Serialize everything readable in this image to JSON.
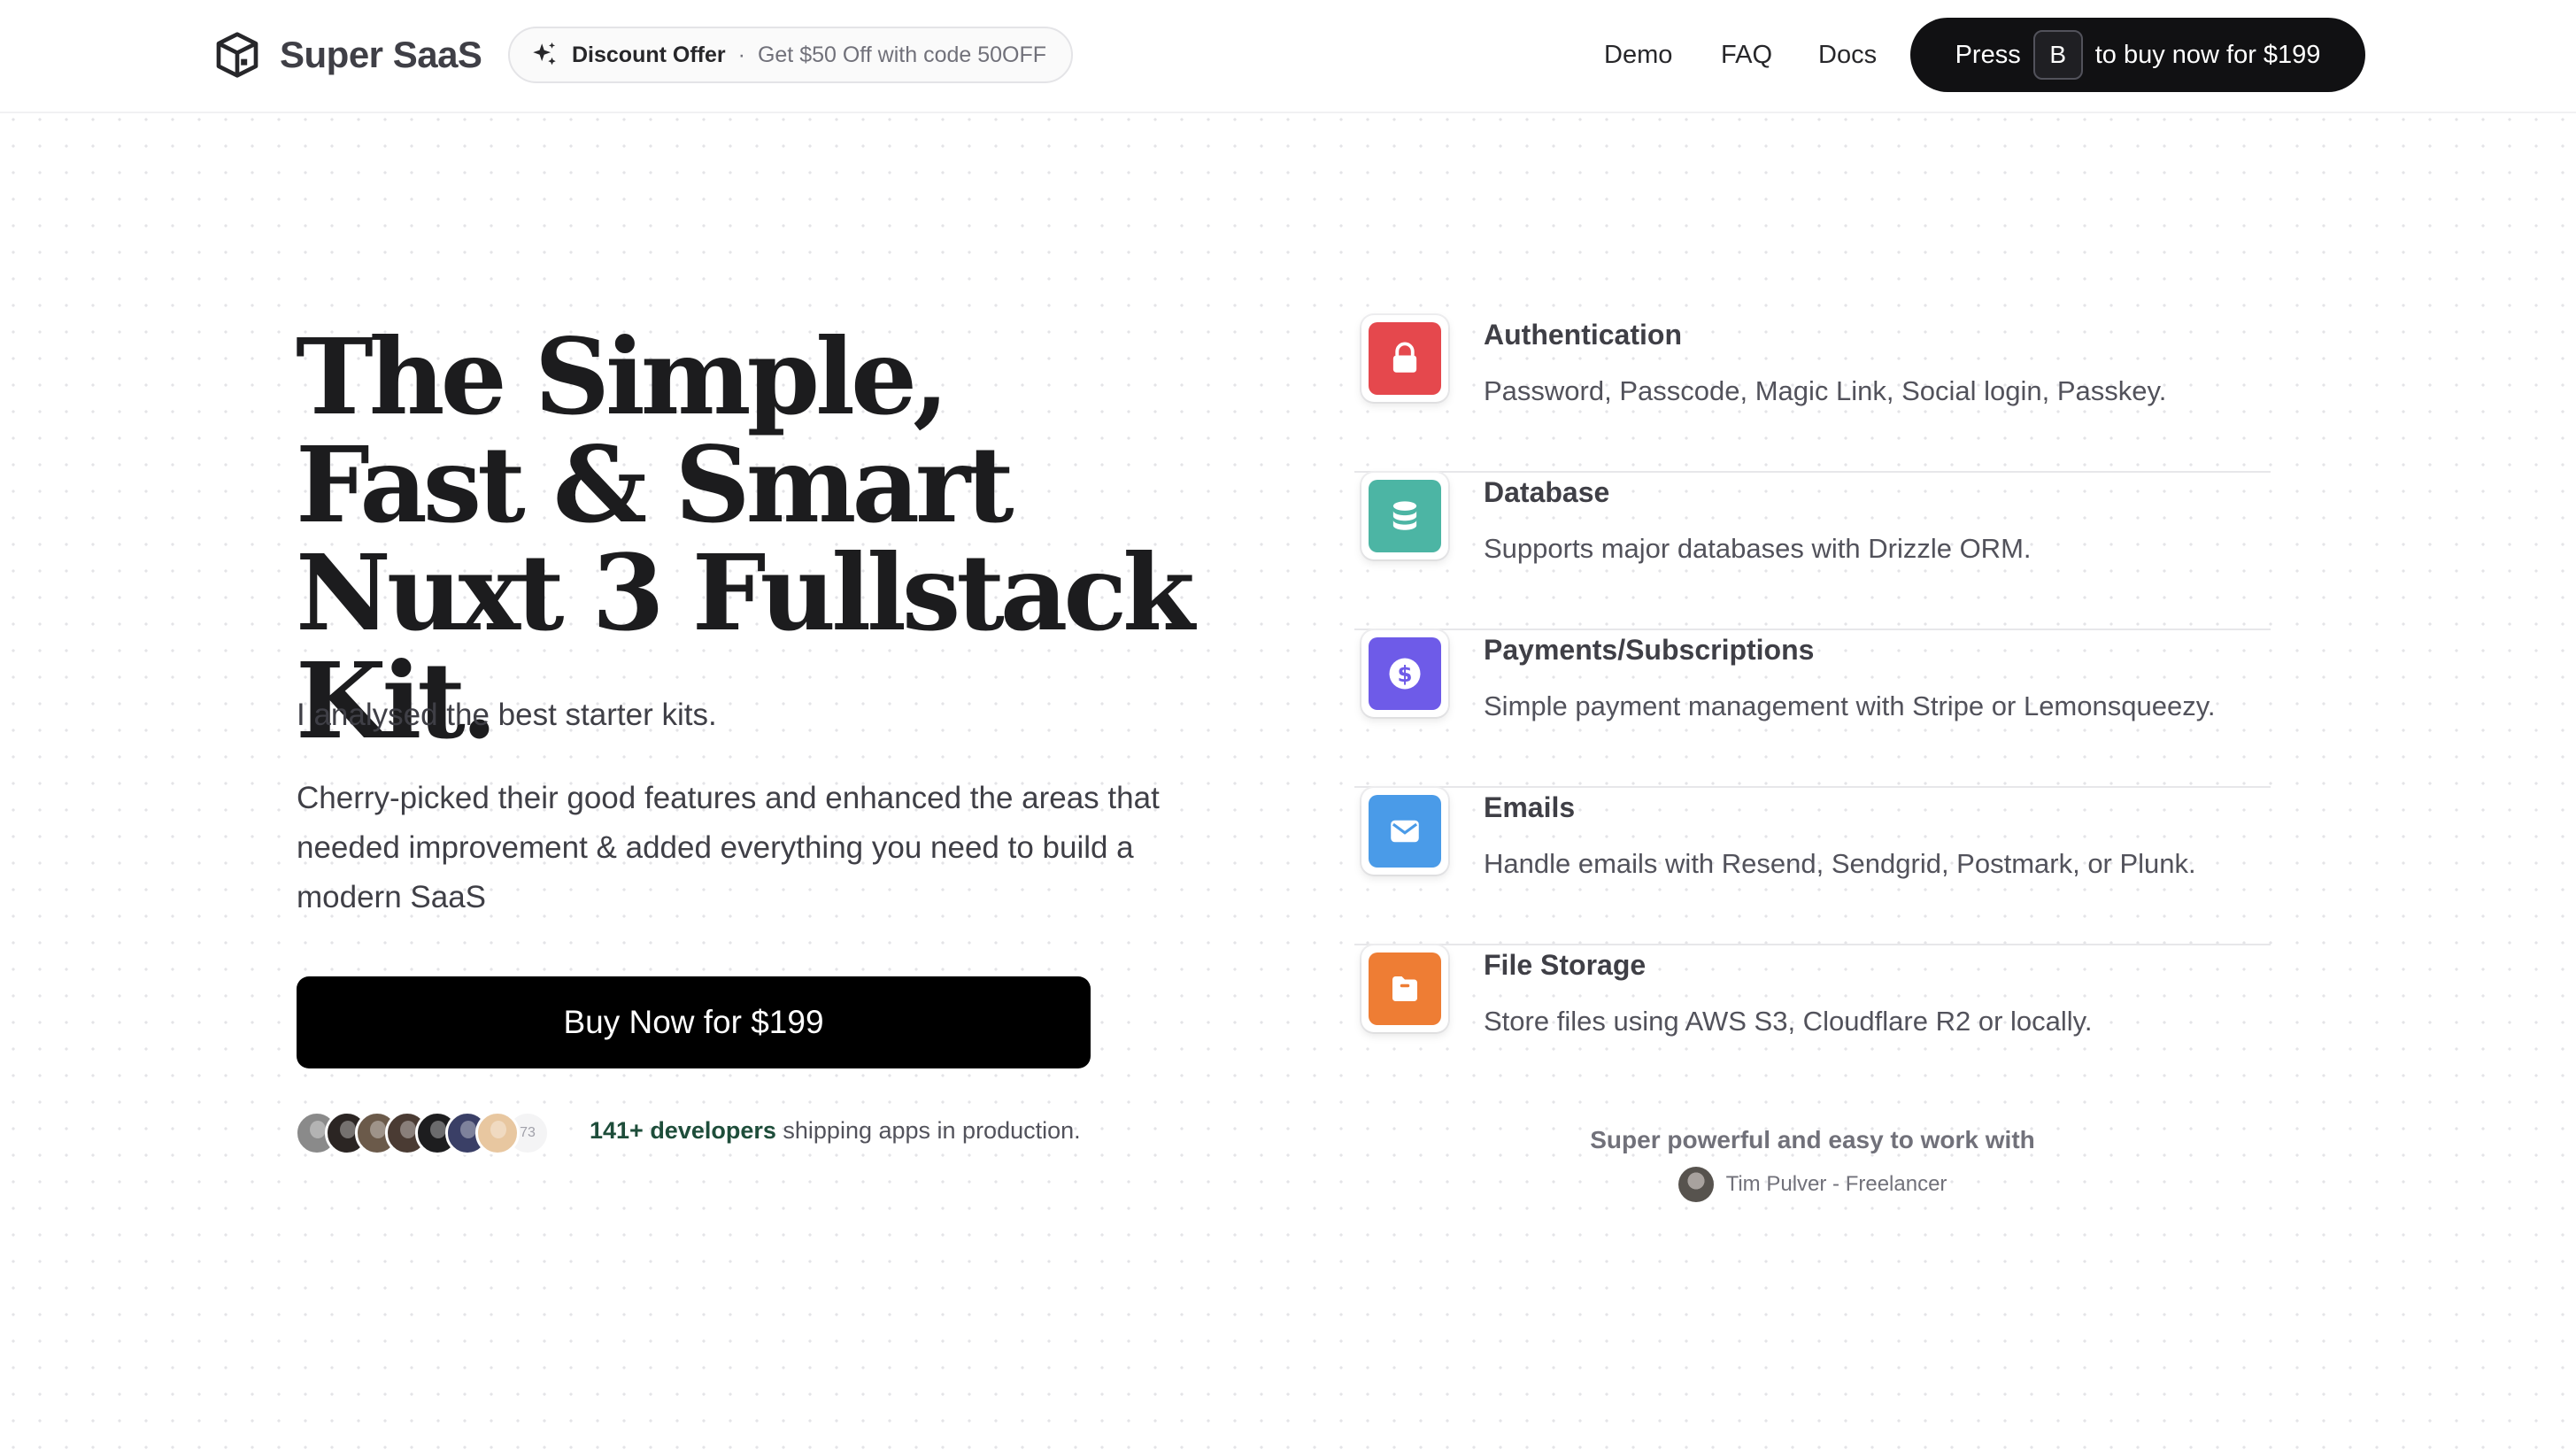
{
  "header": {
    "brand": "Super SaaS",
    "discount": {
      "title": "Discount Offer",
      "separator": "·",
      "text": "Get $50 Off with code 50OFF"
    },
    "nav": [
      "Demo",
      "FAQ",
      "Docs"
    ],
    "cta": {
      "prefix": "Press",
      "key": "B",
      "suffix": "to buy now for $199"
    }
  },
  "hero": {
    "title": "The Simple, Fast & Smart Nuxt 3 Fullstack Kit.",
    "paragraph1": "I analysed the best starter kits.",
    "paragraph2": "Cherry-picked their good features and enhanced the areas that needed improvement & added everything you need to build a modern SaaS",
    "buy_label": "Buy Now for $199",
    "avatar_count": "73",
    "proof_highlight": "141+ developers",
    "proof_rest": "shipping apps in production."
  },
  "features": [
    {
      "title": "Authentication",
      "description": "Password, Passcode, Magic Link, Social login, Passkey.",
      "icon": "lock-icon",
      "color": "#e5484d"
    },
    {
      "title": "Database",
      "description": "Supports major databases with Drizzle ORM.",
      "icon": "database-icon",
      "color": "#4cb5a4"
    },
    {
      "title": "Payments/Subscriptions",
      "description": "Simple payment management with Stripe or Lemonsqueezy.",
      "icon": "dollar-icon",
      "color": "#6e5be8"
    },
    {
      "title": "Emails",
      "description": "Handle emails with Resend, Sendgrid, Postmark, or Plunk.",
      "icon": "mail-icon",
      "color": "#4a9be8"
    },
    {
      "title": "File Storage",
      "description": "Store files using AWS S3, Cloudflare R2 or locally.",
      "icon": "folder-icon",
      "color": "#ee7d34"
    }
  ],
  "testimonial": {
    "quote": "Super powerful and easy to work with",
    "author": "Tim Pulver - Freelancer"
  }
}
